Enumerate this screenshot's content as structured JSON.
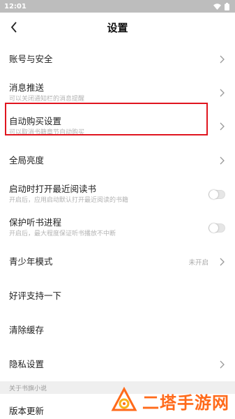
{
  "status": {
    "time": "12:01"
  },
  "header": {
    "title": "设置"
  },
  "rows": [
    {
      "title": "账号与安全",
      "sub": "",
      "value": "",
      "control": "chevron"
    },
    {
      "title": "消息推送",
      "sub": "可以关闭通知栏的消息提醒",
      "value": "",
      "control": "chevron"
    },
    {
      "title": "自动购买设置",
      "sub": "可以取消书籍章节自动购买",
      "value": "",
      "control": "chevron"
    },
    {
      "title": "全局亮度",
      "sub": "",
      "value": "",
      "control": "chevron"
    },
    {
      "title": "启动时打开最近阅读书",
      "sub": "开启后，应用启动默认打开最近阅读的书籍",
      "value": "",
      "control": "toggle"
    },
    {
      "title": "保护听书进程",
      "sub": "开启后，最大程度保证听书播放不中断",
      "value": "",
      "control": "toggle"
    },
    {
      "title": "青少年模式",
      "sub": "",
      "value": "未开启",
      "control": "chevron"
    },
    {
      "title": "好评支持一下",
      "sub": "",
      "value": "",
      "control": "none"
    },
    {
      "title": "清除缓存",
      "sub": "",
      "value": "",
      "control": "none"
    },
    {
      "title": "隐私设置",
      "sub": "",
      "value": "",
      "control": "chevron"
    }
  ],
  "section": {
    "label": "关于书旗小说"
  },
  "about_rows": [
    {
      "title": "版本更新"
    }
  ],
  "watermark": {
    "text": "二塔手游网"
  },
  "colors": {
    "highlight": "#e0151f",
    "watermark": "#ff6a1a",
    "statusbar": "#bdbdbd"
  }
}
